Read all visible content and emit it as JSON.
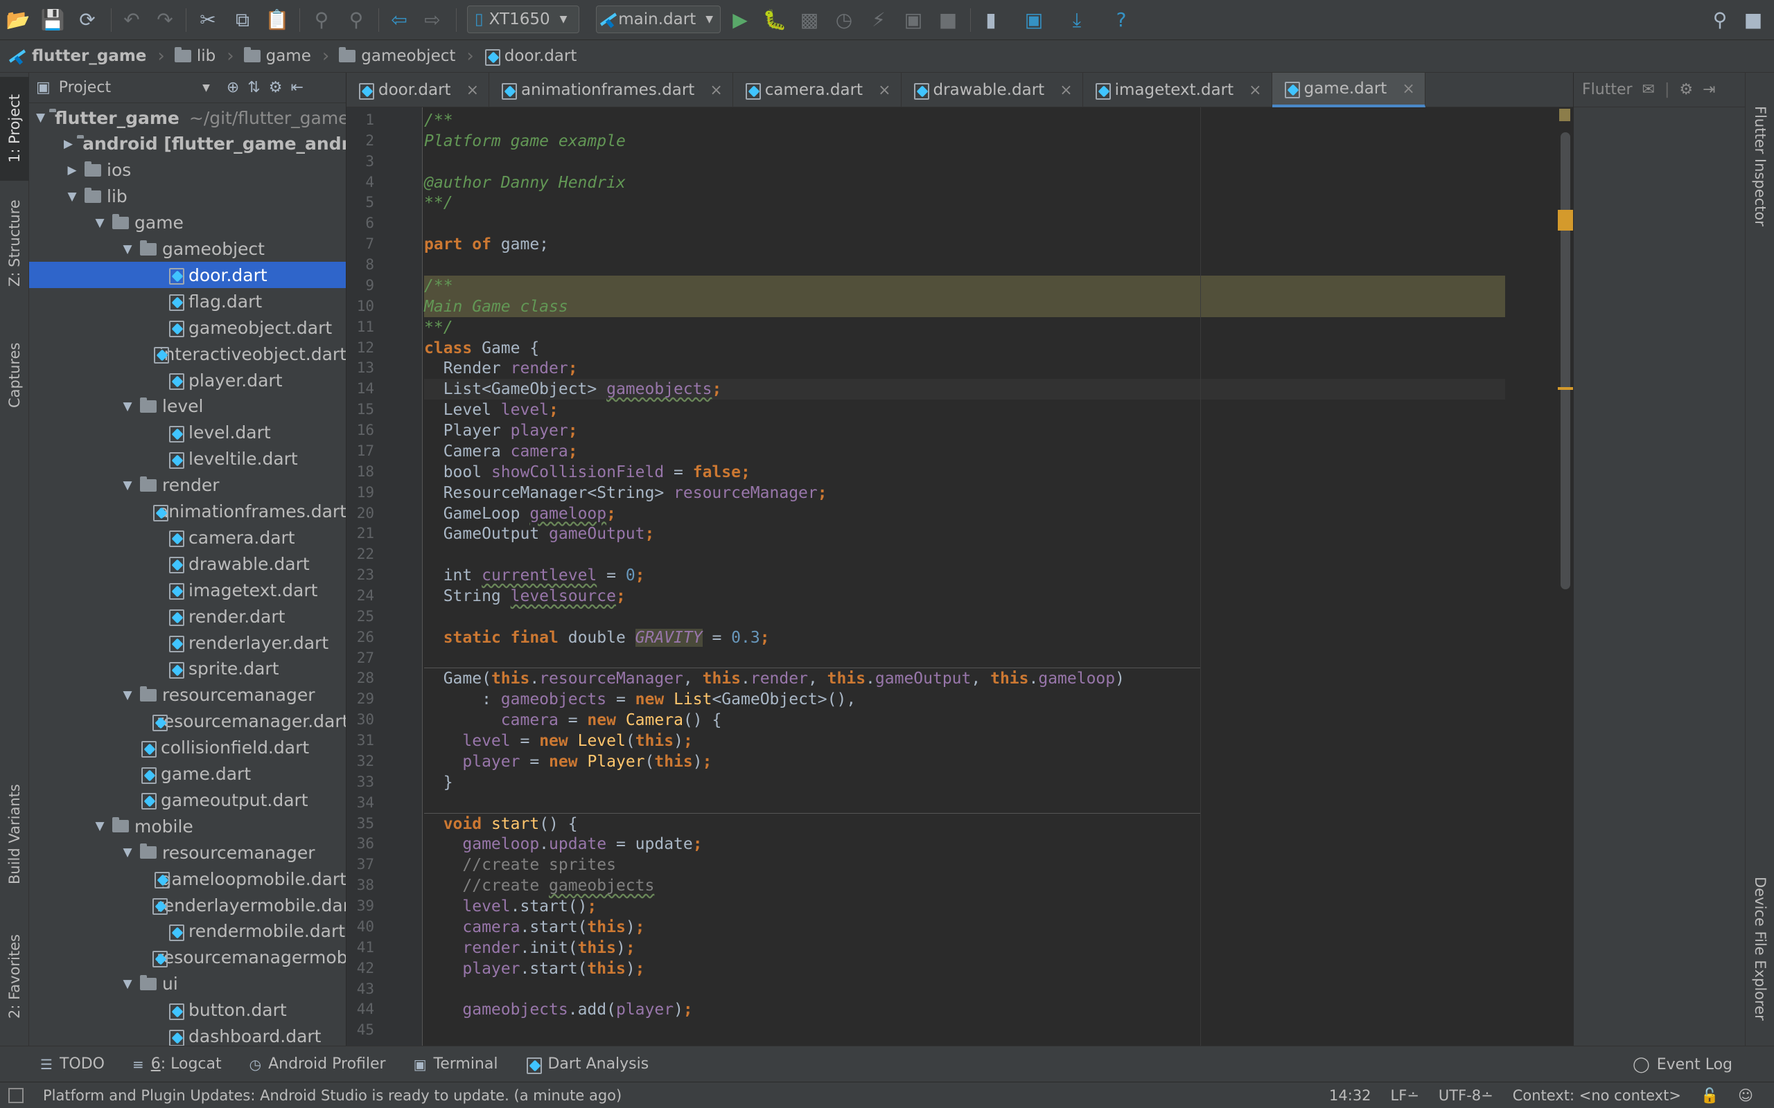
{
  "toolbar": {
    "device": "XT1650",
    "run_config": "main.dart"
  },
  "breadcrumb": [
    "flutter_game",
    "lib",
    "game",
    "gameobject",
    "door.dart"
  ],
  "left_tools": {
    "project": "1: Project",
    "structure": "Z: Structure",
    "captures": "Captures",
    "build_variants": "Build Variants",
    "favorites": "2: Favorites"
  },
  "right_tools": {
    "flutter_inspector": "Flutter Inspector",
    "device_file_explorer": "Device File Explorer"
  },
  "project_panel": {
    "title": "Project",
    "tree": [
      {
        "depth": 0,
        "type": "project",
        "expanded": true,
        "label": "flutter_game",
        "hint": "~/git/flutter_game"
      },
      {
        "depth": 1,
        "type": "module",
        "expanded": false,
        "label": "android [flutter_game_android]",
        "bold": true
      },
      {
        "depth": 1,
        "type": "folder",
        "expanded": false,
        "label": "ios"
      },
      {
        "depth": 1,
        "type": "folder",
        "expanded": true,
        "label": "lib"
      },
      {
        "depth": 2,
        "type": "folder",
        "expanded": true,
        "label": "game"
      },
      {
        "depth": 3,
        "type": "folder",
        "expanded": true,
        "label": "gameobject"
      },
      {
        "depth": 4,
        "type": "file",
        "label": "door.dart",
        "selected": true
      },
      {
        "depth": 4,
        "type": "file",
        "label": "flag.dart"
      },
      {
        "depth": 4,
        "type": "file",
        "label": "gameobject.dart"
      },
      {
        "depth": 4,
        "type": "file",
        "label": "interactiveobject.dart"
      },
      {
        "depth": 4,
        "type": "file",
        "label": "player.dart"
      },
      {
        "depth": 3,
        "type": "folder",
        "expanded": true,
        "label": "level"
      },
      {
        "depth": 4,
        "type": "file",
        "label": "level.dart"
      },
      {
        "depth": 4,
        "type": "file",
        "label": "leveltile.dart"
      },
      {
        "depth": 3,
        "type": "folder",
        "expanded": true,
        "label": "render"
      },
      {
        "depth": 4,
        "type": "file",
        "label": "animationframes.dart"
      },
      {
        "depth": 4,
        "type": "file",
        "label": "camera.dart"
      },
      {
        "depth": 4,
        "type": "file",
        "label": "drawable.dart"
      },
      {
        "depth": 4,
        "type": "file",
        "label": "imagetext.dart"
      },
      {
        "depth": 4,
        "type": "file",
        "label": "render.dart"
      },
      {
        "depth": 4,
        "type": "file",
        "label": "renderlayer.dart"
      },
      {
        "depth": 4,
        "type": "file",
        "label": "sprite.dart"
      },
      {
        "depth": 3,
        "type": "folder",
        "expanded": true,
        "label": "resourcemanager"
      },
      {
        "depth": 4,
        "type": "file",
        "label": "resourcemanager.dart"
      },
      {
        "depth": 3,
        "type": "file",
        "label": "collisionfield.dart"
      },
      {
        "depth": 3,
        "type": "file",
        "label": "game.dart"
      },
      {
        "depth": 3,
        "type": "file",
        "label": "gameoutput.dart"
      },
      {
        "depth": 2,
        "type": "folder",
        "expanded": true,
        "label": "mobile"
      },
      {
        "depth": 3,
        "type": "folder",
        "expanded": true,
        "label": "resourcemanager"
      },
      {
        "depth": 4,
        "type": "file",
        "label": "gameloopmobile.dart"
      },
      {
        "depth": 4,
        "type": "file",
        "label": "renderlayermobile.dart"
      },
      {
        "depth": 4,
        "type": "file",
        "label": "rendermobile.dart"
      },
      {
        "depth": 4,
        "type": "file",
        "label": "resourcemanagermobile.dart"
      },
      {
        "depth": 3,
        "type": "folder",
        "expanded": true,
        "label": "ui"
      },
      {
        "depth": 4,
        "type": "file",
        "label": "button.dart"
      },
      {
        "depth": 4,
        "type": "file",
        "label": "dashboard.dart"
      }
    ]
  },
  "editor_tabs": [
    {
      "label": "door.dart",
      "active": false
    },
    {
      "label": "animationframes.dart",
      "active": false
    },
    {
      "label": "camera.dart",
      "active": false
    },
    {
      "label": "drawable.dart",
      "active": false
    },
    {
      "label": "imagetext.dart",
      "active": false
    },
    {
      "label": "game.dart",
      "active": true
    }
  ],
  "code_lines": [
    {
      "n": 1,
      "html": "<span class='doc'>/**</span>"
    },
    {
      "n": 2,
      "html": "<span class='doc'>Platform game example</span>"
    },
    {
      "n": 3,
      "html": ""
    },
    {
      "n": 4,
      "html": "<span class='doc'>@author Danny Hendrix</span>"
    },
    {
      "n": 5,
      "html": "<span class='doc'>**/</span>"
    },
    {
      "n": 6,
      "html": ""
    },
    {
      "n": 7,
      "html": "<span class='kw'>part of</span> game;"
    },
    {
      "n": 8,
      "html": ""
    },
    {
      "n": 9,
      "html": "<span class='doc'>/**</span>",
      "hl": true
    },
    {
      "n": 10,
      "html": "<span class='doc'>Main Game class</span>",
      "hl": true
    },
    {
      "n": 11,
      "html": "<span class='doc'>**/</span>"
    },
    {
      "n": 12,
      "html": "<span class='kw'>class</span> Game {"
    },
    {
      "n": 13,
      "html": "  Render <span class='fld'>render</span><span class='kw'>;</span>"
    },
    {
      "n": 14,
      "html": "  List&lt;GameObject&gt; <span class='fld typo'>gameobjects</span><span class='kw'>;</span>",
      "caret": true
    },
    {
      "n": 15,
      "html": "  Level <span class='fld'>level</span><span class='kw'>;</span>"
    },
    {
      "n": 16,
      "html": "  Player <span class='fld'>player</span><span class='kw'>;</span>"
    },
    {
      "n": 17,
      "html": "  Camera <span class='fld'>camera</span><span class='kw'>;</span>"
    },
    {
      "n": 18,
      "html": "  bool <span class='fld'>showCollisionField</span> = <span class='kw'>false;</span>"
    },
    {
      "n": 19,
      "html": "  ResourceManager&lt;String&gt; <span class='fld'>resourceManager</span><span class='kw'>;</span>"
    },
    {
      "n": 20,
      "html": "  GameLoop <span class='fld typo'>gameloop</span><span class='kw'>;</span>"
    },
    {
      "n": 21,
      "html": "  GameOutput <span class='fld'>gameOutput</span><span class='kw'>;</span>"
    },
    {
      "n": 22,
      "html": ""
    },
    {
      "n": 23,
      "html": "  int <span class='fld typo'>currentlevel</span> = <span class='num'>0</span><span class='kw'>;</span>"
    },
    {
      "n": 24,
      "html": "  String <span class='fld typo'>levelsource</span><span class='kw'>;</span>"
    },
    {
      "n": 25,
      "html": ""
    },
    {
      "n": 26,
      "html": "  <span class='kw'>static final</span> double <span class='gravity'>GRAVITY</span> = <span class='num'>0.3</span><span class='kw'>;</span>"
    },
    {
      "n": 27,
      "html": ""
    },
    {
      "n": 28,
      "html": "  Game(<span class='kw'>this</span>.<span class='fld'>resourceManager</span>, <span class='kw'>this</span>.<span class='fld'>render</span>, <span class='kw'>this</span>.<span class='fld'>gameOutput</span>, <span class='kw'>this</span>.<span class='fld'>gameloop</span>)"
    },
    {
      "n": 29,
      "html": "      : <span class='fld'>gameobjects</span> = <span class='kw'>new</span> <span class='fn'>List</span>&lt;GameObject&gt;(),"
    },
    {
      "n": 30,
      "html": "        <span class='fld'>camera</span> = <span class='kw'>new</span> <span class='fn'>Camera</span>() {"
    },
    {
      "n": 31,
      "html": "    <span class='fld'>level</span> = <span class='kw'>new</span> <span class='fn'>Level</span>(<span class='kw'>this</span>)<span class='kw'>;</span>"
    },
    {
      "n": 32,
      "html": "    <span class='fld'>player</span> = <span class='kw'>new</span> <span class='fn'>Player</span>(<span class='kw'>this</span>)<span class='kw'>;</span>"
    },
    {
      "n": 33,
      "html": "  }"
    },
    {
      "n": 34,
      "html": ""
    },
    {
      "n": 35,
      "html": "  <span class='kw'>void</span> <span class='fn'>start</span>() {"
    },
    {
      "n": 36,
      "html": "    <span class='fld'>gameloop</span>.<span class='fld'>update</span> = update<span class='kw'>;</span>"
    },
    {
      "n": 37,
      "html": "    <span class='cmt'>//create sprites</span>"
    },
    {
      "n": 38,
      "html": "    <span class='cmt'>//create <span class='typo'>gameobjects</span></span>"
    },
    {
      "n": 39,
      "html": "    <span class='fld'>level</span>.start()<span class='kw'>;</span>"
    },
    {
      "n": 40,
      "html": "    <span class='fld'>camera</span>.start(<span class='kw'>this</span>)<span class='kw'>;</span>"
    },
    {
      "n": 41,
      "html": "    <span class='fld'>render</span>.init(<span class='kw'>this</span>)<span class='kw'>;</span>"
    },
    {
      "n": 42,
      "html": "    <span class='fld'>player</span>.start(<span class='kw'>this</span>)<span class='kw'>;</span>"
    },
    {
      "n": 43,
      "html": ""
    },
    {
      "n": 44,
      "html": "    <span class='fld'>gameobjects</span>.add(<span class='fld'>player</span>)<span class='kw'>;</span>"
    },
    {
      "n": 45,
      "html": ""
    }
  ],
  "flutter_panel": {
    "title": "Flutter"
  },
  "bottom_tools": {
    "todo": "TODO",
    "logcat_num": "6",
    "logcat": ": Logcat",
    "profiler": "Android Profiler",
    "terminal": "Terminal",
    "dart_analysis": "Dart Analysis",
    "event_log": "Event Log"
  },
  "status": {
    "message": "Platform and Plugin Updates: Android Studio is ready to update. (a minute ago)",
    "position": "14:32",
    "line_sep": "LF∸",
    "encoding": "UTF-8∸",
    "context": "Context: <no context>"
  },
  "colors": {
    "selection": "#2f65ca",
    "doc_comment": "#629755",
    "keyword": "#cc7832",
    "field": "#9876aa",
    "number": "#6897bb"
  }
}
